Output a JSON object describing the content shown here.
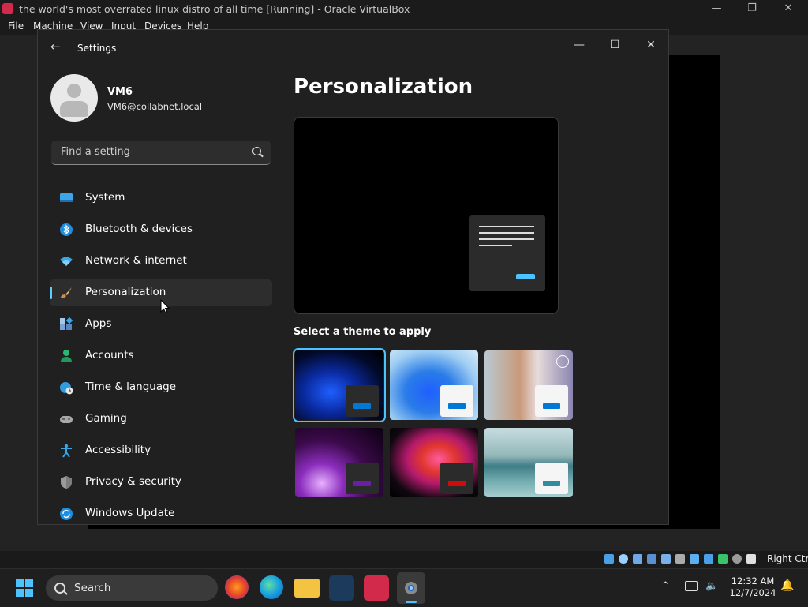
{
  "virtualbox": {
    "title": "the world's most overrated linux distro of all time [Running] - Oracle VirtualBox",
    "menu": [
      "File",
      "Machine",
      "View",
      "Input",
      "Devices",
      "Help"
    ],
    "host_key": "Right Ctrl"
  },
  "settings": {
    "window_title": "Settings",
    "user": {
      "name": "VM6",
      "email": "VM6@collabnet.local"
    },
    "search_placeholder": "Find a setting",
    "nav": [
      {
        "label": "System",
        "icon": "monitor-icon"
      },
      {
        "label": "Bluetooth & devices",
        "icon": "bluetooth-icon"
      },
      {
        "label": "Network & internet",
        "icon": "wifi-icon"
      },
      {
        "label": "Personalization",
        "icon": "paintbrush-icon",
        "active": true
      },
      {
        "label": "Apps",
        "icon": "apps-icon"
      },
      {
        "label": "Accounts",
        "icon": "person-icon"
      },
      {
        "label": "Time & language",
        "icon": "globe-clock-icon"
      },
      {
        "label": "Gaming",
        "icon": "gamepad-icon"
      },
      {
        "label": "Accessibility",
        "icon": "accessibility-icon"
      },
      {
        "label": "Privacy & security",
        "icon": "shield-icon"
      },
      {
        "label": "Windows Update",
        "icon": "update-icon"
      }
    ],
    "page_title": "Personalization",
    "themes_label": "Select a theme to apply",
    "themes": [
      {
        "name": "windows-dark",
        "selected": true,
        "accent": "#0078d4"
      },
      {
        "name": "windows-light",
        "accent": "#0078d4"
      },
      {
        "name": "windows-spotlight",
        "accent": "#0078d4"
      },
      {
        "name": "glow",
        "accent": "#6b1fa8"
      },
      {
        "name": "captured-motion",
        "accent": "#d10a0a"
      },
      {
        "name": "flow",
        "accent": "#2f8da0"
      }
    ]
  },
  "taskbar": {
    "search_label": "Search",
    "time": "12:32 AM",
    "date": "12/7/2024"
  },
  "colors": {
    "accent": "#4cc2ff"
  }
}
